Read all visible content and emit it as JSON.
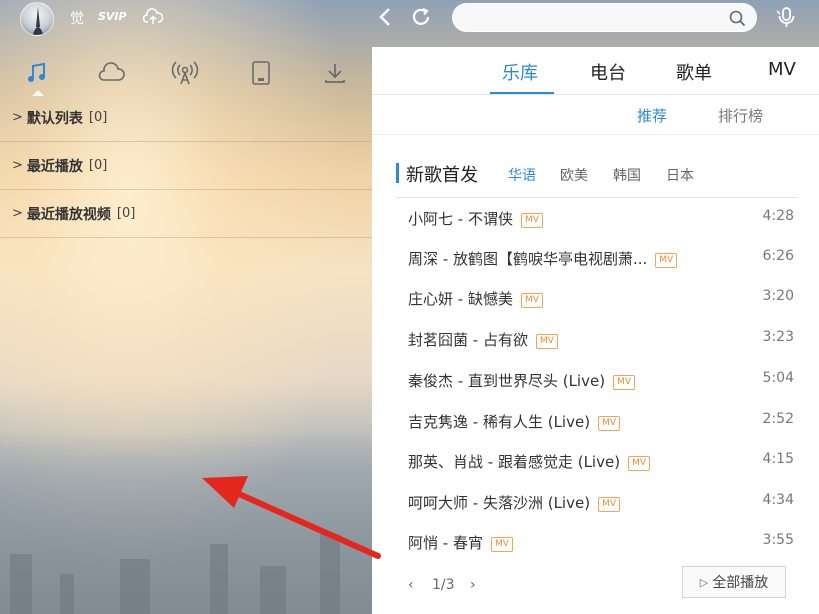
{
  "user": {
    "name": "觉",
    "vip": "SVIP"
  },
  "search": {
    "value": ""
  },
  "left_tabs": [
    {
      "icon": "music-note-icon",
      "active": true
    },
    {
      "icon": "cloud-icon"
    },
    {
      "icon": "radio-broadcast-icon"
    },
    {
      "icon": "device-icon"
    },
    {
      "icon": "download-icon"
    }
  ],
  "playlists": [
    {
      "title": "默认列表",
      "count": "[0]"
    },
    {
      "title": "最近播放",
      "count": "[0]"
    },
    {
      "title": "最近播放视频",
      "count": "[0]"
    }
  ],
  "main_tabs": [
    "乐库",
    "电台",
    "歌单",
    "MV"
  ],
  "sub_tabs": [
    "推荐",
    "排行榜"
  ],
  "section": {
    "title": "新歌首发",
    "languages": [
      "华语",
      "欧美",
      "韩国",
      "日本"
    ]
  },
  "songs": [
    {
      "title": "小阿七 - 不谓侠",
      "tag": "MV",
      "duration": "4:28"
    },
    {
      "title": "周深 - 放鹤图【鹤唳华亭电视剧萧...",
      "tag": "MV",
      "duration": "6:26"
    },
    {
      "title": "庄心妍 - 缺憾美",
      "tag": "MV",
      "duration": "3:20"
    },
    {
      "title": "封茗囧菌 - 占有欲",
      "tag": "MV",
      "duration": "3:23"
    },
    {
      "title": "秦俊杰 - 直到世界尽头 (Live)",
      "tag": "MV",
      "duration": "5:04"
    },
    {
      "title": "吉克隽逸 - 稀有人生 (Live)",
      "tag": "MV",
      "duration": "2:52"
    },
    {
      "title": "那英、肖战 - 跟着感觉走 (Live)",
      "tag": "MV",
      "duration": "4:15"
    },
    {
      "title": "呵呵大师 - 失落沙洲 (Live)",
      "tag": "MV",
      "duration": "4:34"
    },
    {
      "title": "阿悄 - 春宵",
      "tag": "MV",
      "duration": "3:55"
    }
  ],
  "pager": {
    "page": "1/3"
  },
  "play_all_label": "全部播放",
  "colors": {
    "accent": "#2b8ad8",
    "tag": "#f08c2e",
    "arrow": "#e5261e"
  }
}
